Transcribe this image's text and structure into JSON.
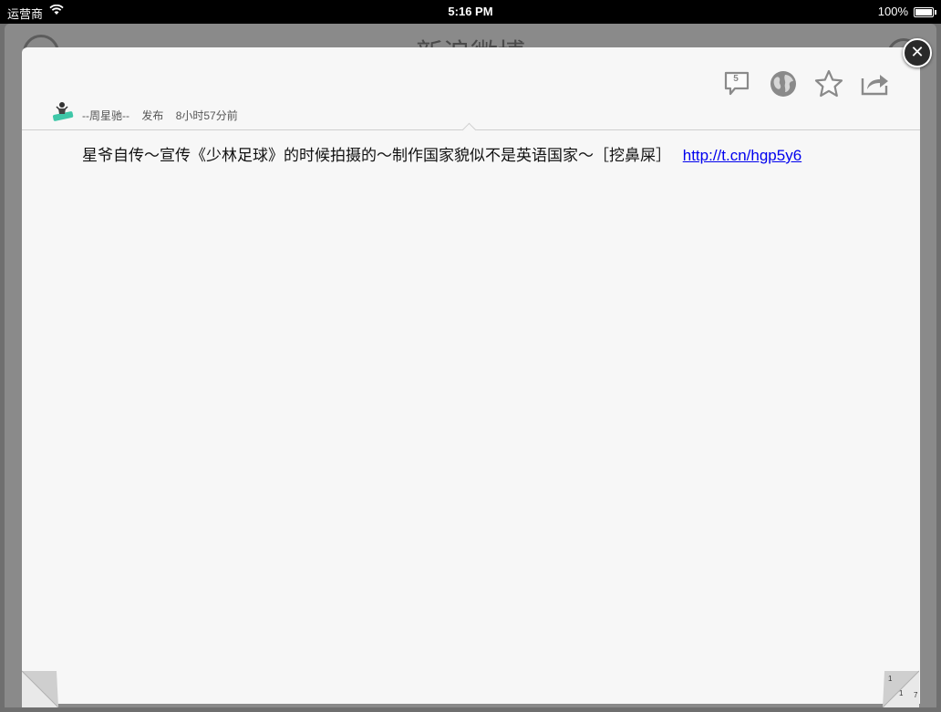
{
  "status_bar": {
    "carrier": "运营商",
    "time": "5:16 PM",
    "battery": "100%"
  },
  "background_app": {
    "title": "新浪微博"
  },
  "post": {
    "author": "--周星驰--",
    "action": "发布",
    "time_ago": "8小时57分前",
    "text": "星爷自传～宣传《少林足球》的时候拍摄的～制作国家貌似不是英语国家～［挖鼻屎］",
    "link": "http://t.cn/hgp5y6",
    "comment_count": "5"
  },
  "toolbar": {
    "icons": [
      "comment-icon",
      "globe-icon",
      "star-icon",
      "share-icon"
    ]
  },
  "page_curl": {
    "right_page_a": "1",
    "right_page_b": "1",
    "right_page_c": "7"
  },
  "colors": {
    "sheet_bg": "#f7f7f7",
    "link": "#0000ee",
    "icon": "#8a8a8a"
  }
}
